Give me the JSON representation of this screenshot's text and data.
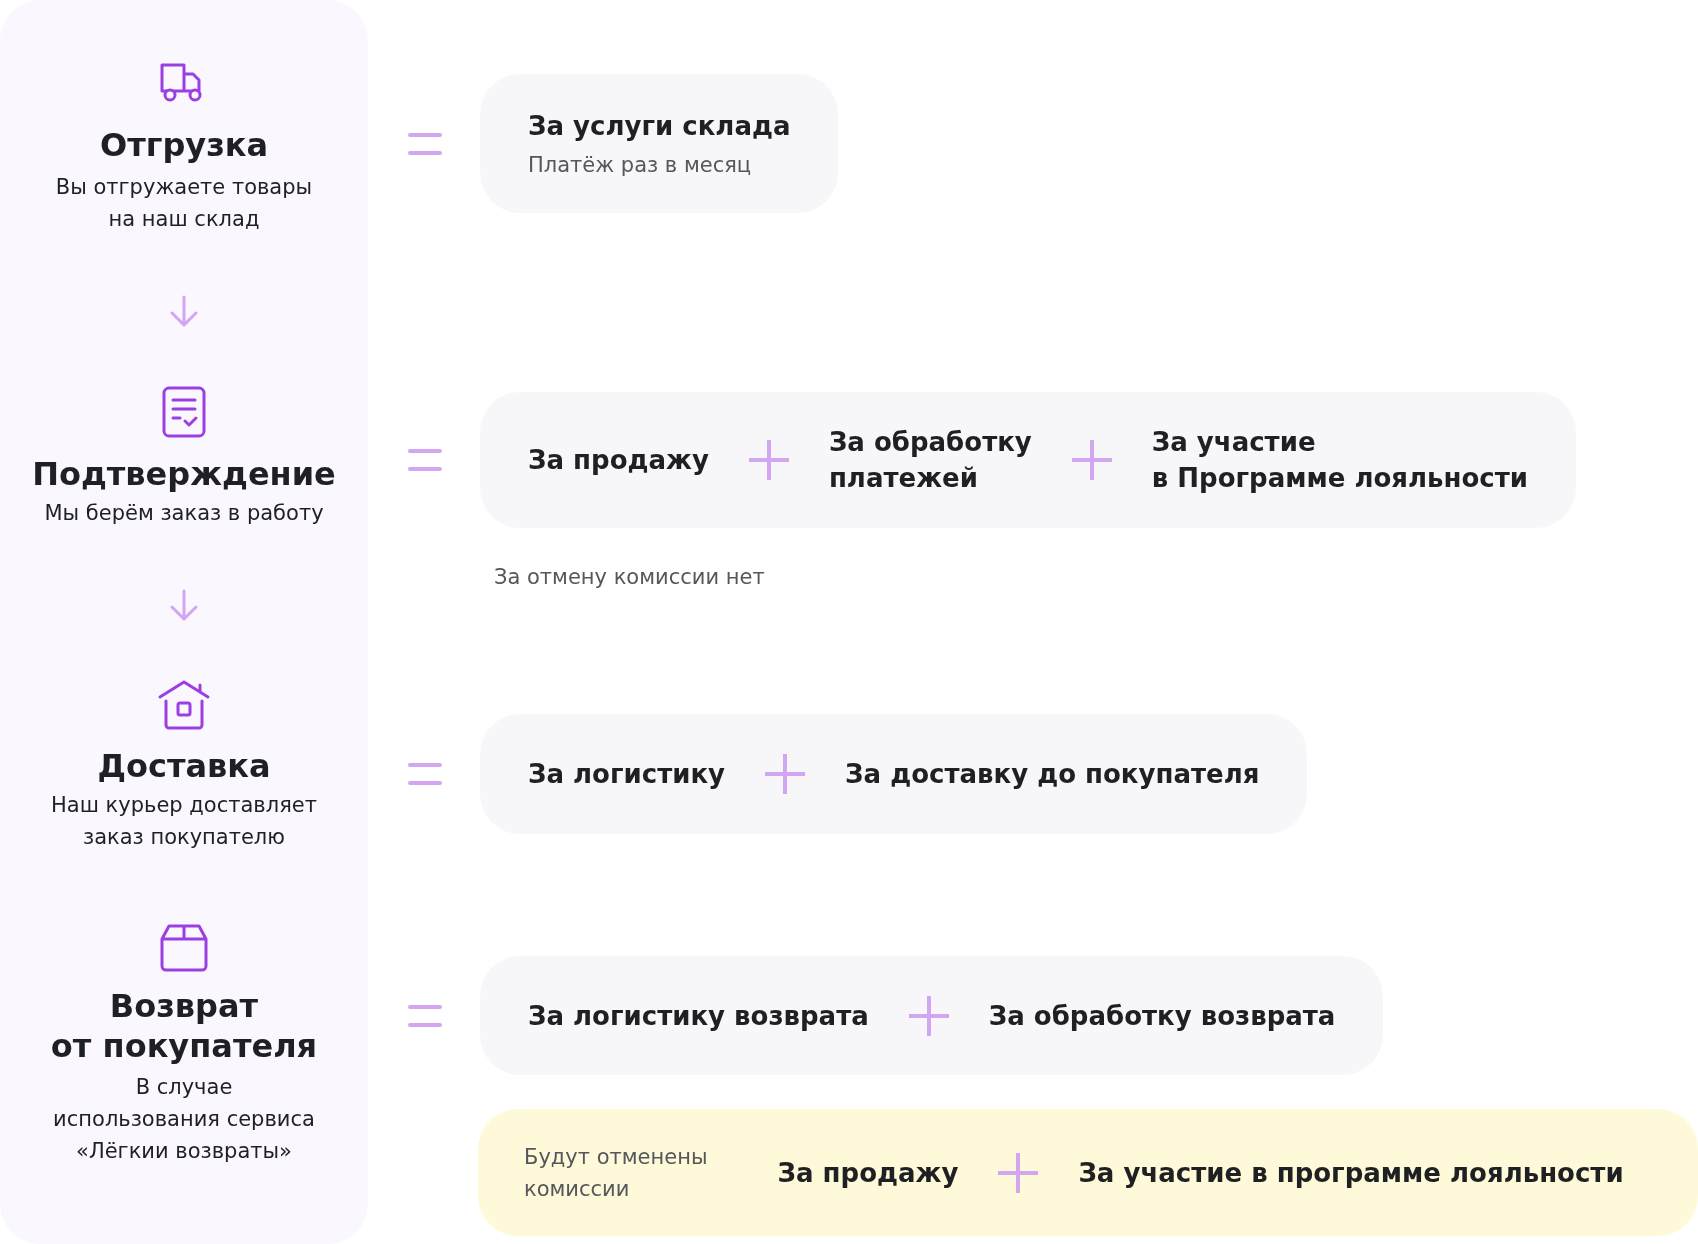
{
  "steps": [
    {
      "title": "Отгрузка",
      "description": "Вы отгружаете товары\nна наш склад"
    },
    {
      "title": "Подтверждение",
      "description": "Мы берём заказ в работу"
    },
    {
      "title": "Доставка",
      "description": "Наш курьер доставляет\nзаказ покупателю"
    },
    {
      "title": "Возврат\nот покупателя",
      "description": "В случае\nиспользования сервиса\n«Лёгкии возвраты»"
    }
  ],
  "fees": [
    {
      "kind": "single",
      "title": "За услуги склада",
      "subtitle": "Платёж раз в месяц"
    },
    {
      "kind": "sum",
      "terms": [
        "За продажу",
        "За обработку\nплатежей",
        "За участие\nв Программе лояльности"
      ],
      "note": "За отмену комиссии нет"
    },
    {
      "kind": "sum",
      "terms": [
        "За логистику",
        "За доставку до покупателя"
      ]
    },
    {
      "kind": "sum",
      "terms": [
        "За логистику возврата",
        "За обработку возврата"
      ]
    }
  ],
  "cancelled": {
    "label": "Будут отменены\nкомиссии",
    "terms": [
      "За продажу",
      "За участие в программе лояльности"
    ]
  }
}
